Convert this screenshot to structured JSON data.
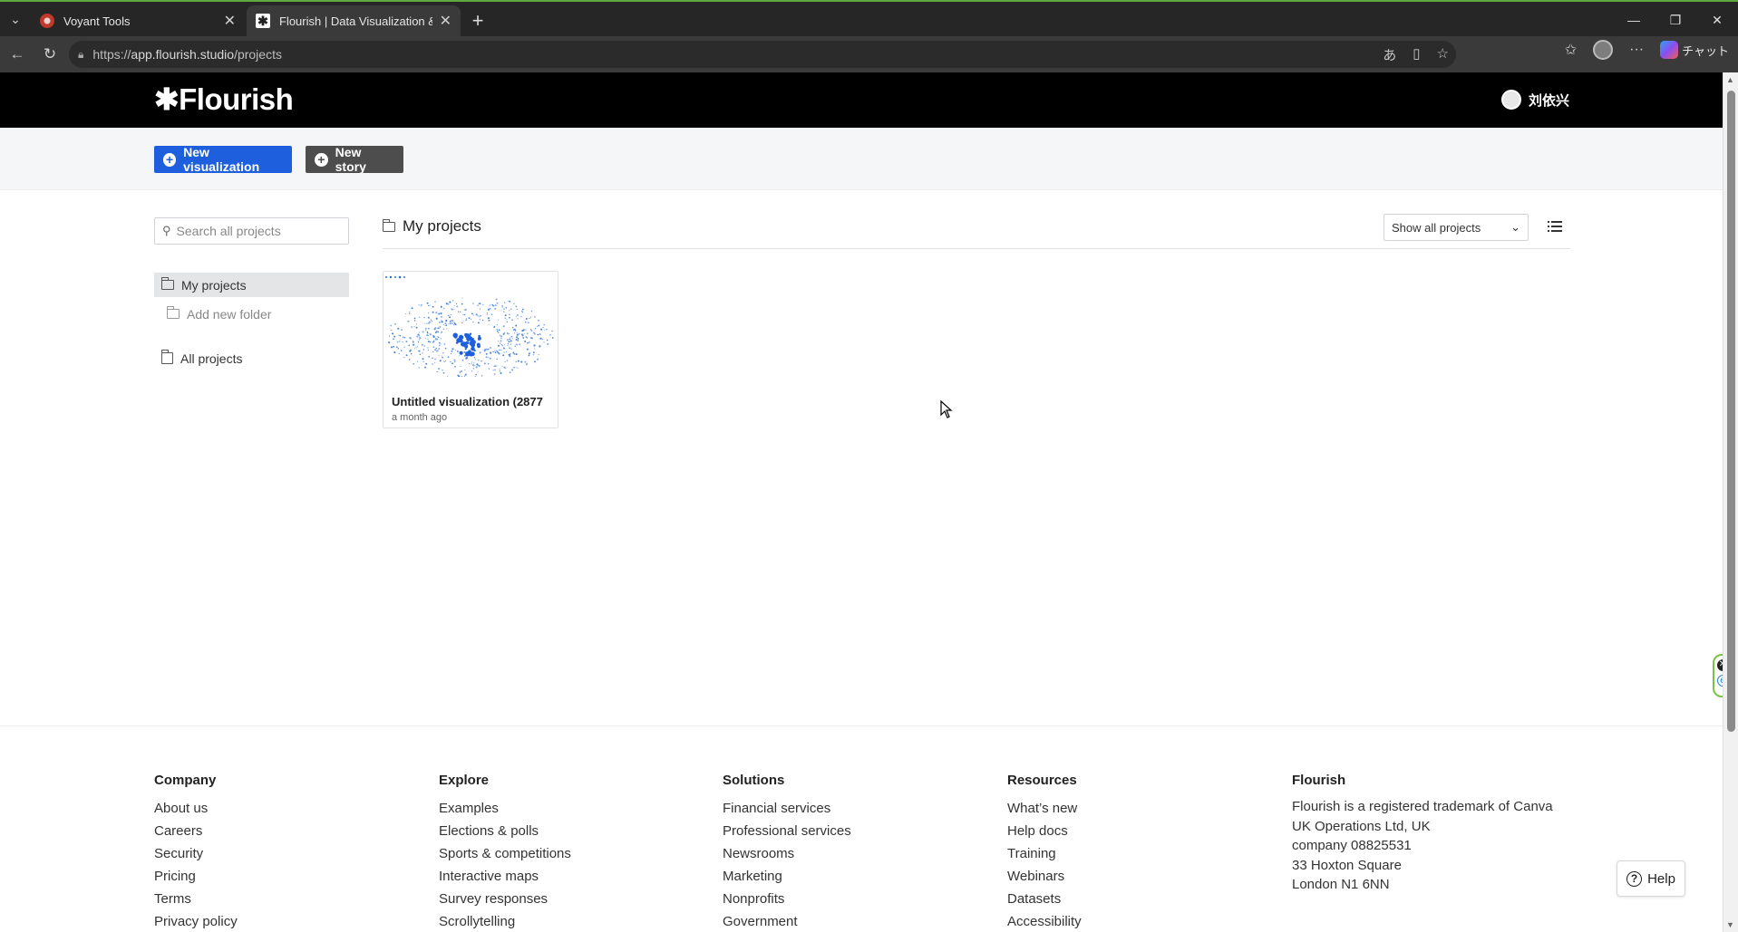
{
  "browser": {
    "tabs": [
      {
        "title": "Voyant Tools",
        "active": false
      },
      {
        "title": "Flourish | Data Visualization & Sto",
        "active": true
      }
    ],
    "url_prefix": "https://",
    "url_host": "app.flourish.studio",
    "url_path": "/projects",
    "copilot_label": "チャット"
  },
  "header": {
    "logo": "✱Flourish",
    "user_name": "刘依兴"
  },
  "actions": {
    "new_visualization": "New visualization",
    "new_story": "New story"
  },
  "sidebar": {
    "search_placeholder": "Search all projects",
    "my_projects": "My projects",
    "add_folder": "Add new folder",
    "all_projects": "All projects"
  },
  "main": {
    "title": "My projects",
    "filter_selected": "Show all projects",
    "project": {
      "title": "Untitled visualization (2877",
      "date": "a month ago"
    }
  },
  "footer": {
    "company": {
      "heading": "Company",
      "links": [
        "About us",
        "Careers",
        "Security",
        "Pricing",
        "Terms",
        "Privacy policy"
      ]
    },
    "explore": {
      "heading": "Explore",
      "links": [
        "Examples",
        "Elections & polls",
        "Sports & competitions",
        "Interactive maps",
        "Survey responses",
        "Scrollytelling"
      ]
    },
    "solutions": {
      "heading": "Solutions",
      "links": [
        "Financial services",
        "Professional services",
        "Newsrooms",
        "Marketing",
        "Nonprofits",
        "Government"
      ]
    },
    "resources": {
      "heading": "Resources",
      "links": [
        "What’s new",
        "Help docs",
        "Training",
        "Webinars",
        "Datasets",
        "Accessibility"
      ]
    },
    "flourish": {
      "heading": "Flourish",
      "lines": [
        "Flourish is a registered trademark of Canva",
        "UK Operations Ltd, UK",
        "company 08825531",
        "33 Hoxton Square",
        "London N1 6NN"
      ]
    }
  },
  "help_label": "Help",
  "colors": {
    "primary": "#1d5fdc",
    "secondary": "#4d4d4d",
    "header_bg": "#000000"
  }
}
